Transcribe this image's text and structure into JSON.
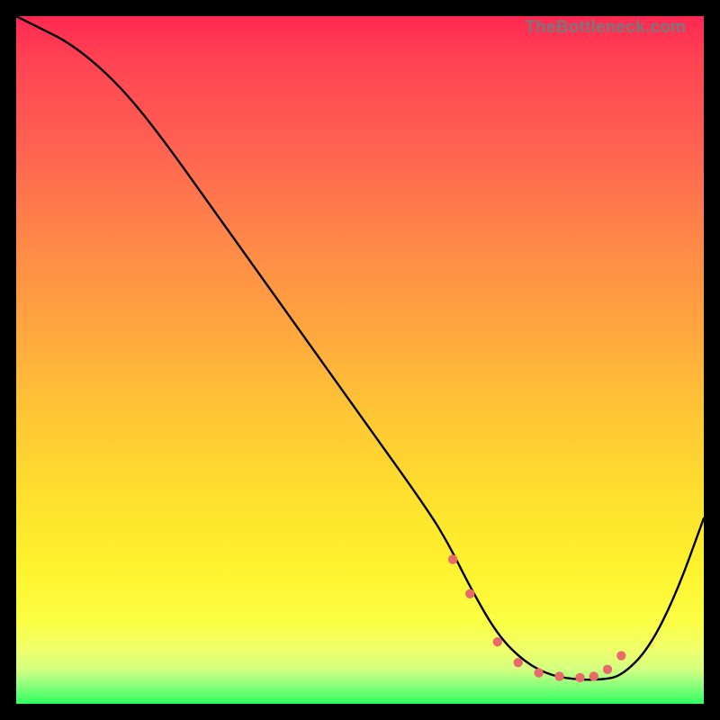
{
  "watermark": "TheBottleneck.com",
  "chart_data": {
    "type": "line",
    "title": "",
    "xlabel": "",
    "ylabel": "",
    "xlim": [
      0,
      100
    ],
    "ylim": [
      0,
      100
    ],
    "grid": false,
    "series": [
      {
        "name": "curve",
        "x": [
          0,
          3,
          8,
          14,
          20,
          30,
          40,
          50,
          60,
          63,
          66,
          70,
          74,
          78,
          82,
          85,
          88,
          92,
          96,
          100
        ],
        "y": [
          100,
          98.5,
          96,
          91,
          84,
          70,
          56,
          42,
          28,
          23,
          17,
          10,
          6,
          4,
          3.5,
          3.5,
          4,
          8,
          16,
          27
        ]
      }
    ],
    "markers": {
      "name": "highlight-dots",
      "color": "#e96a6a",
      "x": [
        63.5,
        66,
        70,
        73,
        76,
        79,
        82,
        84,
        86,
        88
      ],
      "y": [
        21,
        16,
        9,
        6,
        4.5,
        4,
        3.8,
        4,
        5,
        7
      ]
    }
  }
}
